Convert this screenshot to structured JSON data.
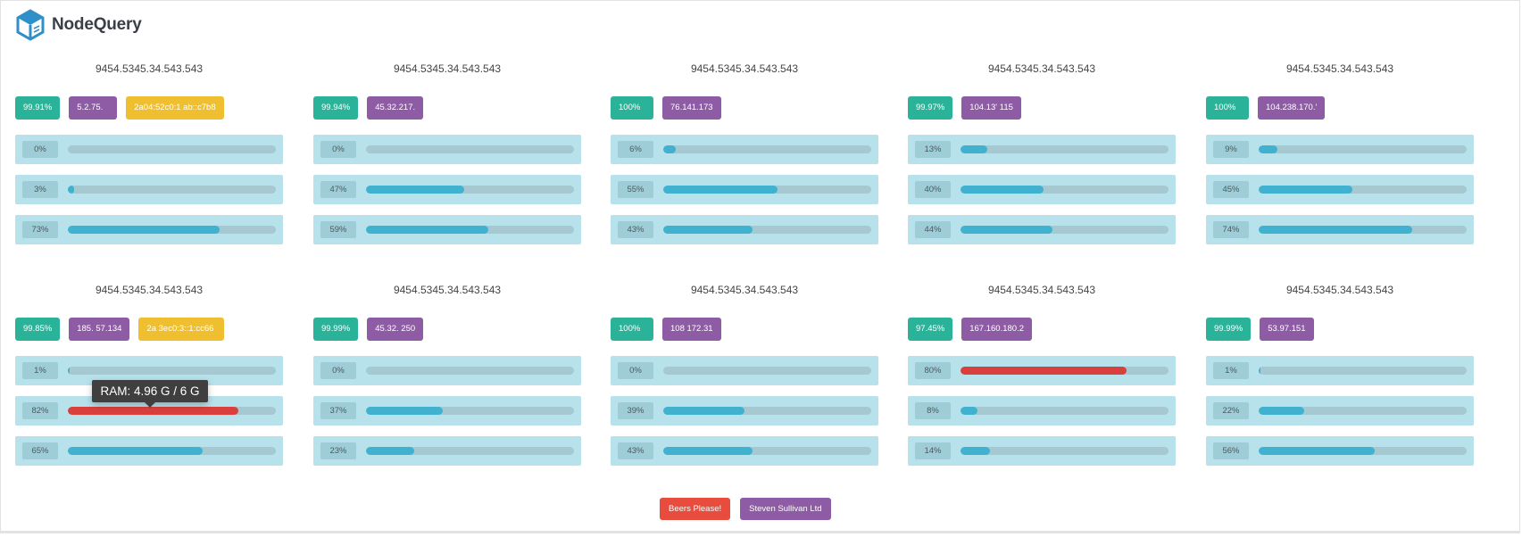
{
  "app": {
    "name": "NodeQuery",
    "accent": "#2f8fc9"
  },
  "colors": {
    "uptime": "#2bb39a",
    "ipv4": "#8e5ca5",
    "ipv6": "#f0bf2f",
    "bar_fill": "#40b2cf",
    "bar_hot": "#d9403d"
  },
  "servers": [
    {
      "title": "9454.5345.34.543.543",
      "uptime": "99.91%",
      "ipv4": "5.2.75.",
      "ipv6": "2a04:52c0:1        ab::c7b8",
      "bars": [
        {
          "label": "0%",
          "value": 0
        },
        {
          "label": "3%",
          "value": 3
        },
        {
          "label": "73%",
          "value": 73
        }
      ]
    },
    {
      "title": "9454.5345.34.543.543",
      "uptime": "99.94%",
      "ipv4": "45.32.217.",
      "ipv6": "",
      "bars": [
        {
          "label": "0%",
          "value": 0
        },
        {
          "label": "47%",
          "value": 47
        },
        {
          "label": "59%",
          "value": 59
        }
      ]
    },
    {
      "title": "9454.5345.34.543.543",
      "uptime": "100%",
      "ipv4": "     76.141.173",
      "ipv6": "",
      "bars": [
        {
          "label": "6%",
          "value": 6
        },
        {
          "label": "55%",
          "value": 55
        },
        {
          "label": "43%",
          "value": 43
        }
      ]
    },
    {
      "title": "9454.5345.34.543.543",
      "uptime": "99.97%",
      "ipv4": "104.13'        115",
      "ipv6": "",
      "bars": [
        {
          "label": "13%",
          "value": 13
        },
        {
          "label": "40%",
          "value": 40
        },
        {
          "label": "44%",
          "value": 44
        }
      ]
    },
    {
      "title": "9454.5345.34.543.543",
      "uptime": "100%",
      "ipv4": "104.238.170.'",
      "ipv6": "",
      "bars": [
        {
          "label": "9%",
          "value": 9
        },
        {
          "label": "45%",
          "value": 45
        },
        {
          "label": "74%",
          "value": 74
        }
      ]
    },
    {
      "title": "9454.5345.34.543.543",
      "uptime": "99.85%",
      "ipv4": "185.          57.134",
      "ipv6": "2a       3ec0:3::1:cc66",
      "bars": [
        {
          "label": "1%",
          "value": 1
        },
        {
          "label": "82%",
          "value": 82
        },
        {
          "label": "65%",
          "value": 65
        }
      ]
    },
    {
      "title": "9454.5345.34.543.543",
      "uptime": "99.99%",
      "ipv4": "45.32.        250",
      "ipv6": "",
      "bars": [
        {
          "label": "0%",
          "value": 0
        },
        {
          "label": "37%",
          "value": 37
        },
        {
          "label": "23%",
          "value": 23
        }
      ]
    },
    {
      "title": "9454.5345.34.543.543",
      "uptime": "100%",
      "ipv4": "108        172.31",
      "ipv6": "",
      "bars": [
        {
          "label": "0%",
          "value": 0
        },
        {
          "label": "39%",
          "value": 39
        },
        {
          "label": "43%",
          "value": 43
        }
      ]
    },
    {
      "title": "9454.5345.34.543.543",
      "uptime": "97.45%",
      "ipv4": "167.160.180.2",
      "ipv6": "",
      "bars": [
        {
          "label": "80%",
          "value": 80
        },
        {
          "label": "8%",
          "value": 8
        },
        {
          "label": "14%",
          "value": 14
        }
      ]
    },
    {
      "title": "9454.5345.34.543.543",
      "uptime": "99.99%",
      "ipv4": "  53.97.151",
      "ipv6": "",
      "bars": [
        {
          "label": "1%",
          "value": 1
        },
        {
          "label": "22%",
          "value": 22
        },
        {
          "label": "56%",
          "value": 56
        }
      ]
    }
  ],
  "tooltip": {
    "text": "RAM: 4.96 G / 6 G"
  },
  "footer": {
    "donate_label": "Beers Please!",
    "company_label": "Steven Sullivan Ltd"
  }
}
